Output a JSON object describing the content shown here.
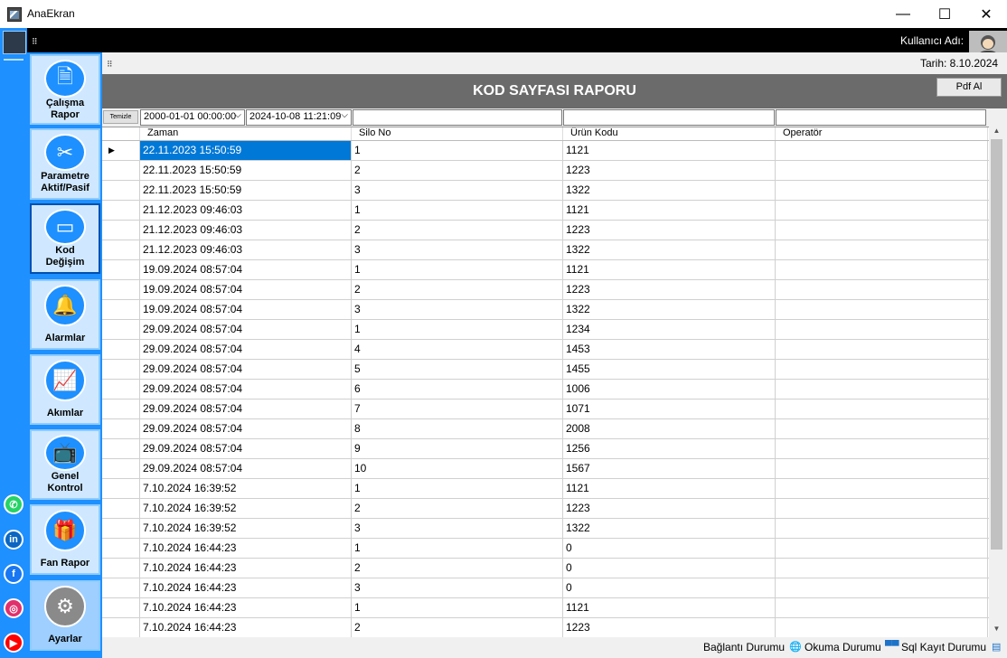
{
  "window": {
    "title": "AnaEkran",
    "min_glyph": "—",
    "max_glyph": "☐",
    "close_glyph": "✕"
  },
  "topbar": {
    "user_label": "Kullanıcı Adı:",
    "grip": "⠿"
  },
  "subbar": {
    "date_label": "Tarih: 8.10.2024",
    "grip": "⠿"
  },
  "nav": [
    {
      "label": "Çalışma\nRapor",
      "icon": "document-icon",
      "glyph": "🗎"
    },
    {
      "label": "Parametre\nAktif/Pasif",
      "icon": "tools-icon",
      "glyph": "✂"
    },
    {
      "label": "Kod\nDeğişim",
      "icon": "card-icon",
      "glyph": "▭"
    },
    {
      "label": "Alarmlar",
      "icon": "bell-icon",
      "glyph": "🔔"
    },
    {
      "label": "Akımlar",
      "icon": "chart-icon",
      "glyph": "📈"
    },
    {
      "label": "Genel\nKontrol",
      "icon": "tv-icon",
      "glyph": "📺"
    },
    {
      "label": "Fan Rapor",
      "icon": "gift-icon",
      "glyph": "🎁"
    },
    {
      "label": "Ayarlar",
      "icon": "gears-icon",
      "glyph": "⚙"
    }
  ],
  "social": [
    {
      "name": "whatsapp-icon",
      "glyph": "✆",
      "color": "#25d366"
    },
    {
      "name": "linkedin-icon",
      "glyph": "in",
      "color": "#0a66c2"
    },
    {
      "name": "facebook-icon",
      "glyph": "f",
      "color": "#1877f2"
    },
    {
      "name": "instagram-icon",
      "glyph": "◎",
      "color": "#e1306c"
    },
    {
      "name": "youtube-icon",
      "glyph": "▶",
      "color": "#ff0000"
    }
  ],
  "report": {
    "title": "KOD SAYFASI RAPORU",
    "pdf_label": "Pdf Al"
  },
  "filters": {
    "clear_label": "Temizle",
    "date_from": "2000-01-01 00:00:00",
    "date_to": "2024-10-08 11:21:09",
    "arrow": "⌵"
  },
  "grid": {
    "columns": [
      "Zaman",
      "Silo No",
      "Ürün Kodu",
      "Operatör"
    ],
    "rows": [
      [
        "22.11.2023 15:50:59",
        "1",
        "1121",
        ""
      ],
      [
        "22.11.2023 15:50:59",
        "2",
        "1223",
        ""
      ],
      [
        "22.11.2023 15:50:59",
        "3",
        "1322",
        ""
      ],
      [
        "21.12.2023 09:46:03",
        "1",
        "1121",
        ""
      ],
      [
        "21.12.2023 09:46:03",
        "2",
        "1223",
        ""
      ],
      [
        "21.12.2023 09:46:03",
        "3",
        "1322",
        ""
      ],
      [
        "19.09.2024 08:57:04",
        "1",
        "1121",
        ""
      ],
      [
        "19.09.2024 08:57:04",
        "2",
        "1223",
        ""
      ],
      [
        "19.09.2024 08:57:04",
        "3",
        "1322",
        ""
      ],
      [
        "29.09.2024 08:57:04",
        "1",
        "1234",
        ""
      ],
      [
        "29.09.2024 08:57:04",
        "4",
        "1453",
        ""
      ],
      [
        "29.09.2024 08:57:04",
        "5",
        "1455",
        ""
      ],
      [
        "29.09.2024 08:57:04",
        "6",
        "1006",
        ""
      ],
      [
        "29.09.2024 08:57:04",
        "7",
        "1071",
        ""
      ],
      [
        "29.09.2024 08:57:04",
        "8",
        "2008",
        ""
      ],
      [
        "29.09.2024 08:57:04",
        "9",
        "1256",
        ""
      ],
      [
        "29.09.2024 08:57:04",
        "10",
        "1567",
        ""
      ],
      [
        "7.10.2024 16:39:52",
        "1",
        "1121",
        ""
      ],
      [
        "7.10.2024 16:39:52",
        "2",
        "1223",
        ""
      ],
      [
        "7.10.2024 16:39:52",
        "3",
        "1322",
        ""
      ],
      [
        "7.10.2024 16:44:23",
        "1",
        "0",
        ""
      ],
      [
        "7.10.2024 16:44:23",
        "2",
        "0",
        ""
      ],
      [
        "7.10.2024 16:44:23",
        "3",
        "0",
        ""
      ],
      [
        "7.10.2024 16:44:23",
        "1",
        "1121",
        ""
      ],
      [
        "7.10.2024 16:44:23",
        "2",
        "1223",
        ""
      ]
    ],
    "selected_row": 0,
    "pointer": "▶"
  },
  "scroll": {
    "up": "▲",
    "down": "▼"
  },
  "status": {
    "connection": "Bağlantı Durumu",
    "read": "Okuma Durumu",
    "sql": "Sql Kayıt Durumu",
    "globe": "🌐",
    "net": "▀▀",
    "db": "▤"
  }
}
